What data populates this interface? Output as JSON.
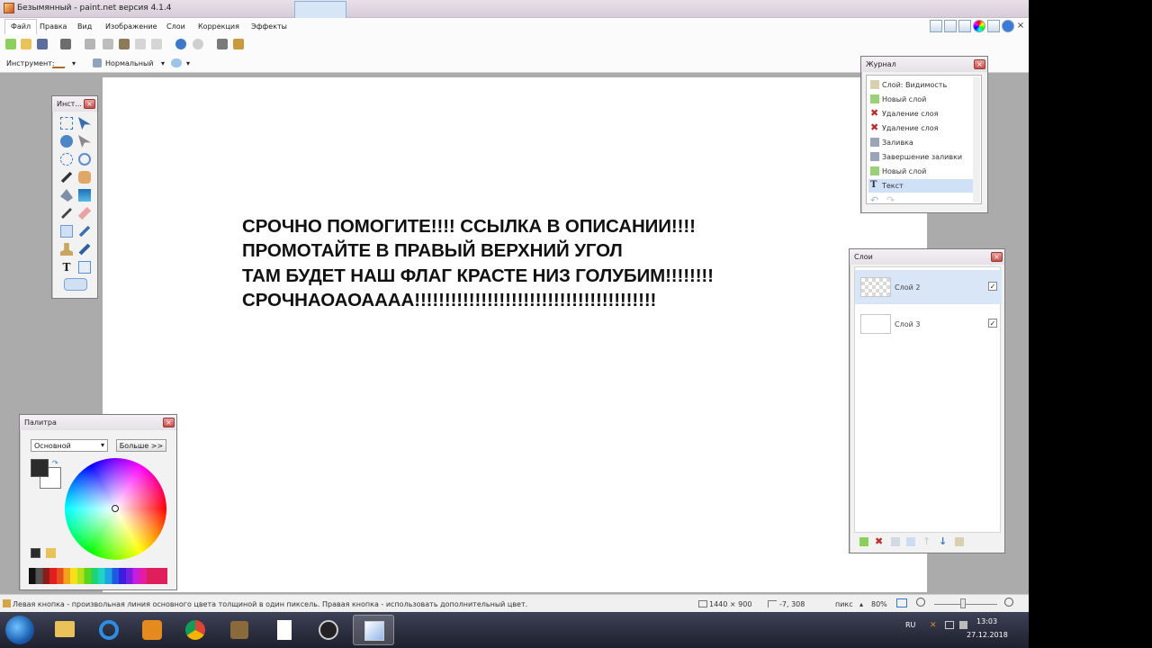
{
  "window": {
    "title": "Безымянный - paint.net версия 4.1.4"
  },
  "menu": [
    "Файл",
    "Правка",
    "Вид",
    "Изображение",
    "Слои",
    "Коррекция",
    "Эффекты"
  ],
  "options": {
    "tool_label": "Инструмент:",
    "blend_mode": "Нормальный"
  },
  "canvas_text": [
    "СРОЧНО ПОМОГИТЕ!!!! ССЫЛКА В ОПИСАНИИ!!!!",
    "ПРОМОТАЙТЕ В ПРАВЫЙ ВЕРХНИЙ УГОЛ",
    "ТАМ БУДЕТ НАШ ФЛАГ КРАСТЕ НИЗ ГОЛУБИМ!!!!!!!!",
    "СРОЧНАОАОАААА!!!!!!!!!!!!!!!!!!!!!!!!!!!!!!!!!!!!!!!!"
  ],
  "tools_panel": {
    "title": "Инст..."
  },
  "history": {
    "title": "Журнал",
    "items": [
      {
        "label": "Слой: Видимость",
        "icon": "layer-visibility-icon"
      },
      {
        "label": "Новый слой",
        "icon": "new-layer-icon"
      },
      {
        "label": "Удаление слоя",
        "icon": "delete-icon"
      },
      {
        "label": "Удаление слоя",
        "icon": "delete-icon"
      },
      {
        "label": "Заливка",
        "icon": "fill-icon"
      },
      {
        "label": "Завершение заливки",
        "icon": "fill-icon"
      },
      {
        "label": "Новый слой",
        "icon": "new-layer-icon"
      },
      {
        "label": "Текст",
        "icon": "text-icon"
      }
    ],
    "selected_index": 7
  },
  "layers": {
    "title": "Слои",
    "items": [
      {
        "name": "Слой 2",
        "visible": true,
        "selected": true
      },
      {
        "name": "Слой 3",
        "visible": true,
        "selected": false
      }
    ]
  },
  "palette": {
    "title": "Палитра",
    "mode": "Основной",
    "more_button": "Больше >>",
    "primary_color": "#2b2b2b",
    "secondary_color": "#ffffff"
  },
  "status": {
    "hint": "Левая кнопка - произвольная линия основного цвета толщиной в один пиксель. Правая кнопка - использовать дополнительный цвет.",
    "image_size": "1440 × 900",
    "cursor_pos": "-7, 308",
    "units": "пикс",
    "zoom": "80%"
  },
  "taskbar": {
    "lang": "RU",
    "time": "13:03",
    "date": "27.12.2018"
  }
}
